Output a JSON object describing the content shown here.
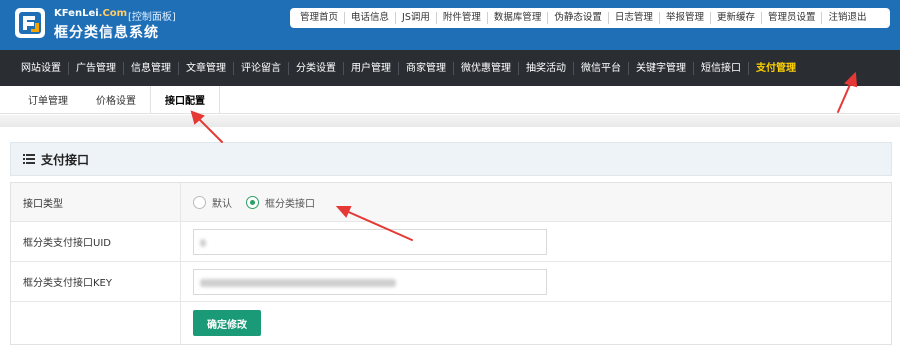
{
  "header": {
    "brand_domain": "KFenLei",
    "brand_domain_suffix": ".Com",
    "brand_panel": "[控制面板]",
    "brand_name": "框分类信息系统",
    "top_links": [
      "管理首页",
      "电话信息",
      "JS调用",
      "附件管理",
      "数据库管理",
      "伪静态设置",
      "日志管理",
      "举报管理",
      "更新缓存",
      "管理员设置",
      "注销退出"
    ]
  },
  "mainnav": {
    "items": [
      "网站设置",
      "广告管理",
      "信息管理",
      "文章管理",
      "评论留言",
      "分类设置",
      "用户管理",
      "商家管理",
      "微优惠管理",
      "抽奖活动",
      "微信平台",
      "关键字管理",
      "短信接口",
      "支付管理"
    ],
    "active_index": 13
  },
  "subnav": {
    "items": [
      "订单管理",
      "价格设置",
      "接口配置"
    ],
    "active_index": 2
  },
  "panel": {
    "title": "支付接口",
    "rows": {
      "type_label": "接口类型",
      "radio_default": "默认",
      "radio_kfl": "框分类接口",
      "radio_selected": "框分类接口",
      "uid_label": "框分类支付接口UID",
      "key_label": "框分类支付接口KEY"
    },
    "submit_label": "确定修改"
  },
  "colors": {
    "header_blue": "#1f6fb7",
    "nav_dark": "#2a2e33",
    "active_yellow": "#ffd200",
    "accent_green": "#1a9a76",
    "arrow_red": "#e53935"
  }
}
